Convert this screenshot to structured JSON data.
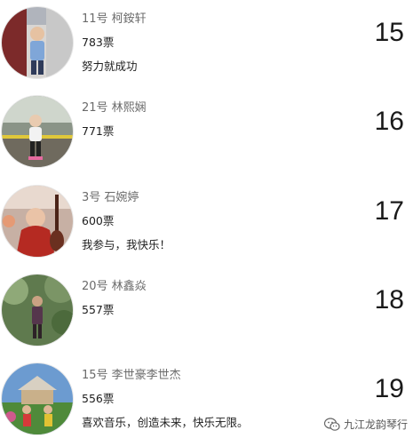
{
  "entries": [
    {
      "name": "11号 柯銨轩",
      "votes": "783票",
      "motto": "努力就成功",
      "rank": "15",
      "avatar_icon": "child-photo-icon"
    },
    {
      "name": "21号 林熙娴",
      "votes": "771票",
      "motto": "",
      "rank": "16",
      "avatar_icon": "child-photo-icon"
    },
    {
      "name": "3号 石婉婷",
      "votes": "600票",
      "motto": "我参与，我快乐！",
      "rank": "17",
      "avatar_icon": "child-photo-icon"
    },
    {
      "name": "20号 林鑫焱",
      "votes": "557票",
      "motto": "",
      "rank": "18",
      "avatar_icon": "child-photo-icon"
    },
    {
      "name": "15号 李世豪李世杰",
      "votes": "556票",
      "motto": "喜欢音乐，创造未来，快乐无限。",
      "rank": "19",
      "avatar_icon": "child-photo-icon"
    }
  ],
  "watermark": {
    "text": "九江龙韵琴行",
    "icon": "wechat-icon"
  }
}
